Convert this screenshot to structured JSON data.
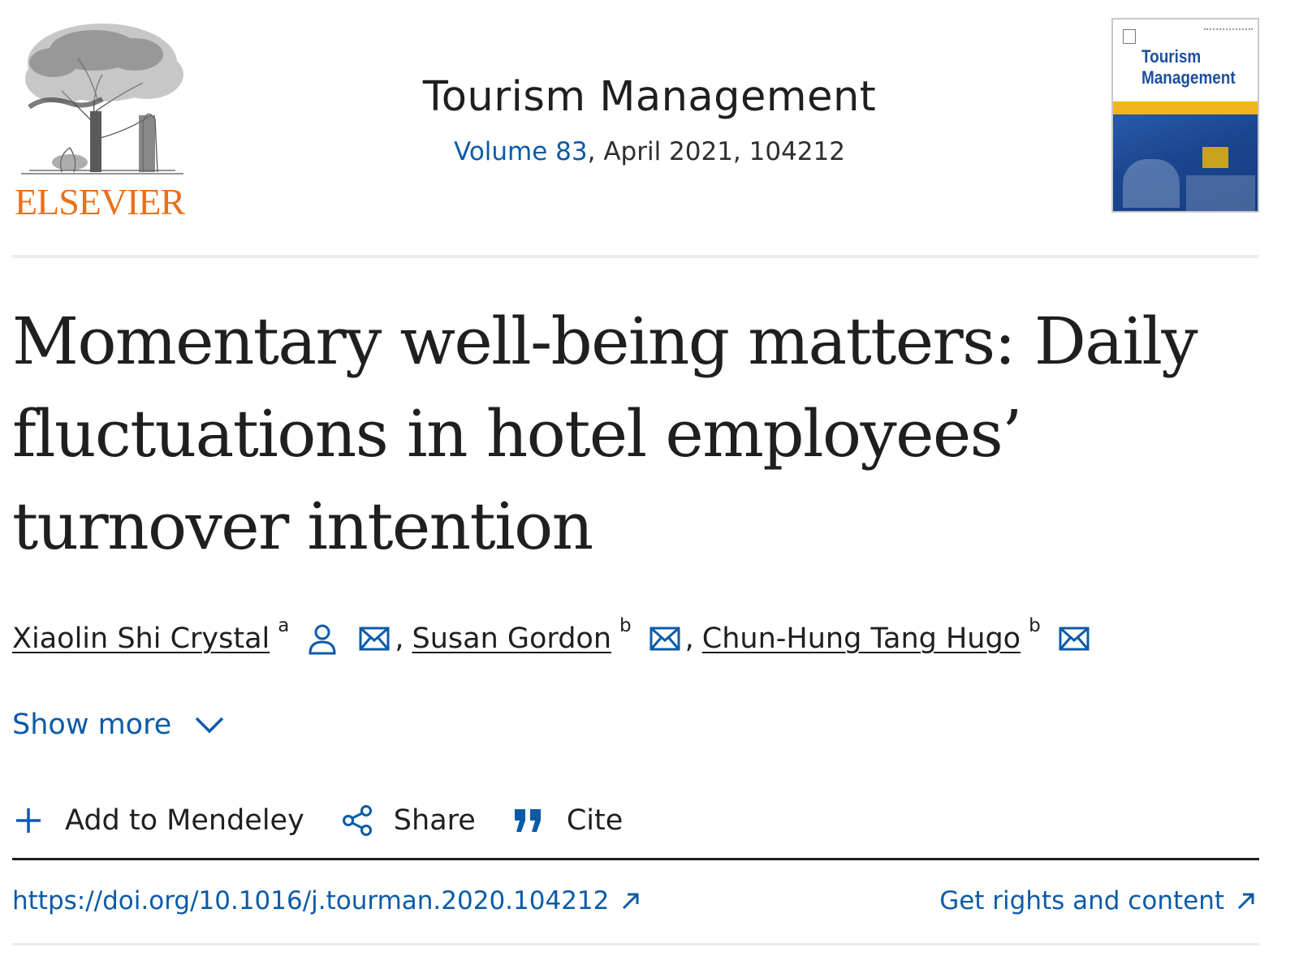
{
  "publisher": {
    "name": "ELSEVIER"
  },
  "journal": {
    "title": "Tourism Management",
    "volume_link": "Volume 83",
    "issue_rest": ", April 2021, 104212",
    "cover_title_line1": "Tourism",
    "cover_title_line2": "Management"
  },
  "article": {
    "title": "Momentary well-being matters: Daily fluctuations in hotel employees’ turnover intention"
  },
  "authors": [
    {
      "name": "Xiaolin Shi Crystal",
      "affiliation": "a",
      "icons": [
        "person-icon",
        "email-icon"
      ]
    },
    {
      "name": "Susan Gordon",
      "affiliation": "b",
      "icons": [
        "email-icon"
      ]
    },
    {
      "name": "Chun-Hung Tang Hugo",
      "affiliation": "b",
      "icons": [
        "email-icon"
      ]
    }
  ],
  "author_separator": ",",
  "show_more": {
    "label": "Show more",
    "icon": "chevron-down-icon"
  },
  "toolbar": {
    "add_to_mendeley": "Add to Mendeley",
    "share": "Share",
    "cite": "Cite"
  },
  "links": {
    "doi": "https://doi.org/10.1016/j.tourman.2020.104212",
    "rights": "Get rights and content"
  },
  "colors": {
    "link_blue": "#0c5ba8",
    "elsevier_orange": "#e9711c",
    "text": "#1f1f1f"
  }
}
